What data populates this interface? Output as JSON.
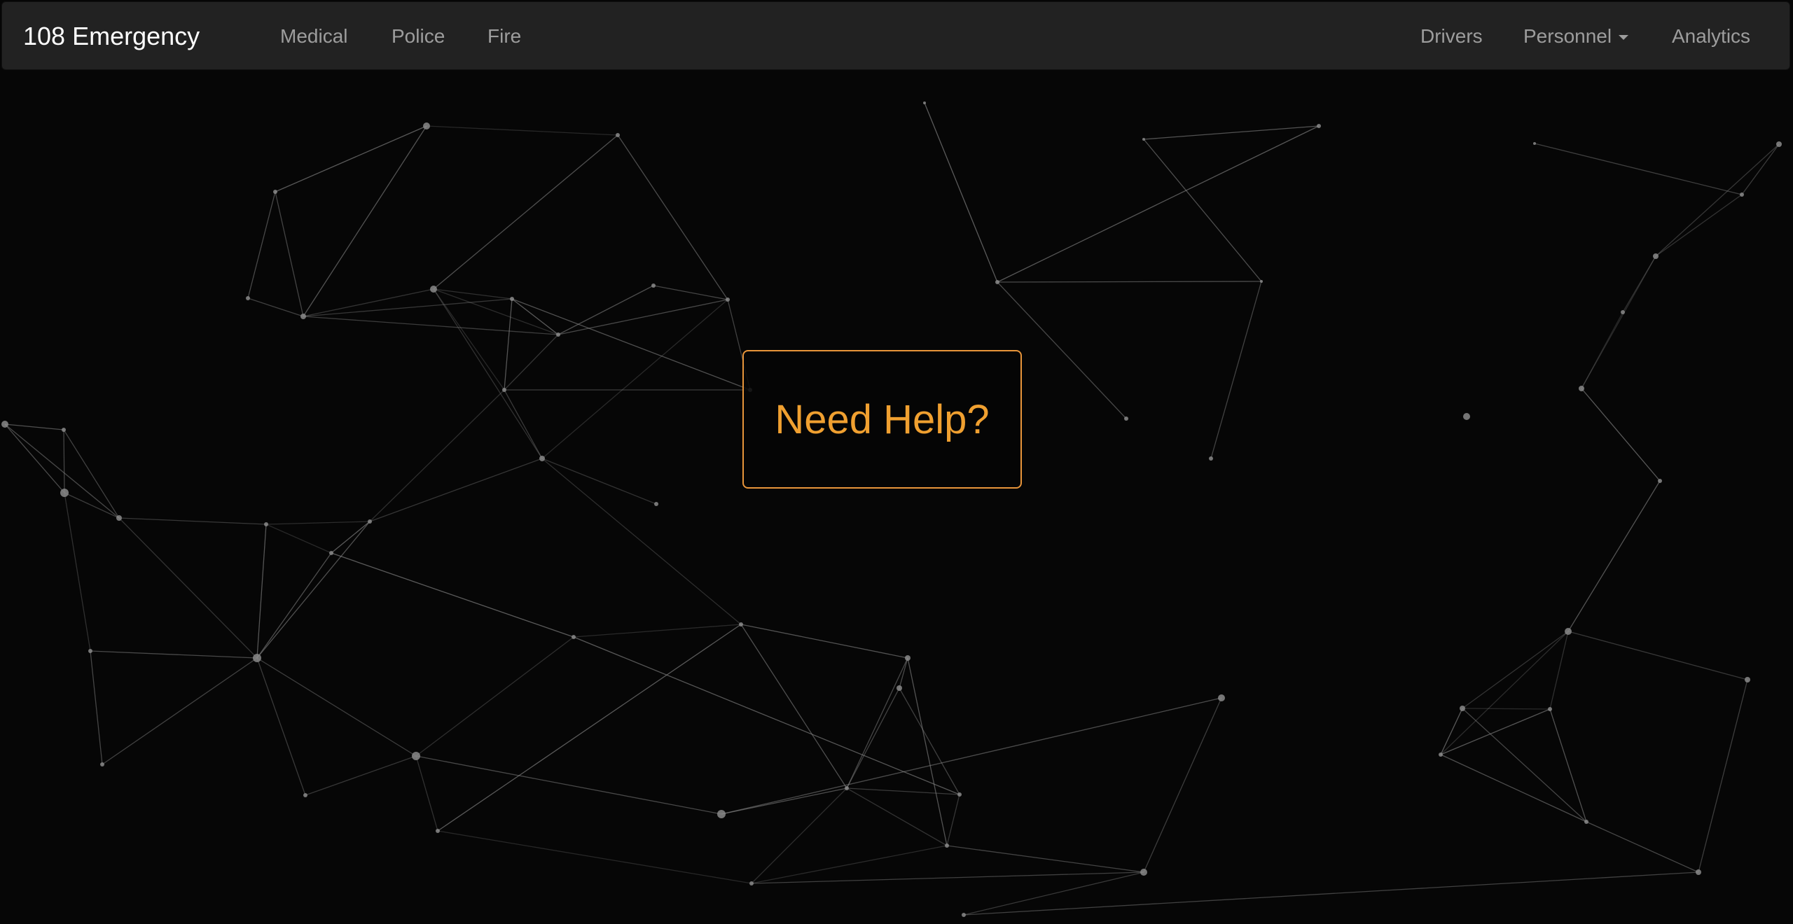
{
  "navbar": {
    "brand": "108 Emergency",
    "left_links": [
      "Medical",
      "Police",
      "Fire"
    ],
    "right_links": {
      "drivers": "Drivers",
      "personnel": "Personnel",
      "analytics": "Analytics"
    }
  },
  "hero": {
    "help_label": "Need Help?"
  },
  "colors": {
    "background": "#060606",
    "navbar": "#222222",
    "accent": "#f0a030",
    "link": "#9d9d9d",
    "network": "#8a8a8a"
  }
}
